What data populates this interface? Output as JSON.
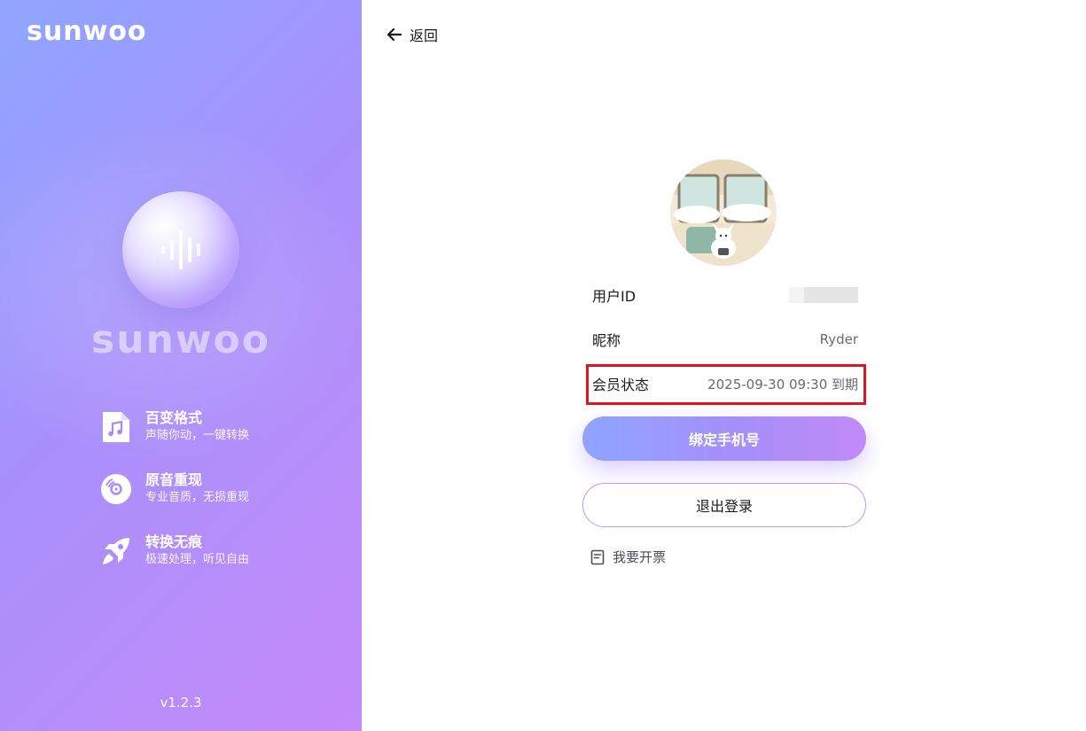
{
  "app": {
    "logo": "sunwoo",
    "big_logo": "sunwoo",
    "version": "v1.2.3"
  },
  "features": [
    {
      "icon": "music-file-icon",
      "title": "百变格式",
      "subtitle": "声随你动，一键转换"
    },
    {
      "icon": "disc-icon",
      "title": "原音重现",
      "subtitle": "专业音质，无损重现"
    },
    {
      "icon": "rocket-icon",
      "title": "转换无痕",
      "subtitle": "极速处理，听见自由"
    }
  ],
  "nav": {
    "back_label": "返回"
  },
  "profile": {
    "user_id_label": "用户ID",
    "nickname_label": "昵称",
    "nickname_value": "Ryder",
    "membership_label": "会员状态",
    "membership_value": "2025-09-30 09:30 到期"
  },
  "actions": {
    "bind_phone": "绑定手机号",
    "logout": "退出登录",
    "invoice": "我要开票"
  },
  "colors": {
    "accent_start": "#8ea4ff",
    "accent_end": "#c18af7",
    "highlight": "#e0141e"
  }
}
